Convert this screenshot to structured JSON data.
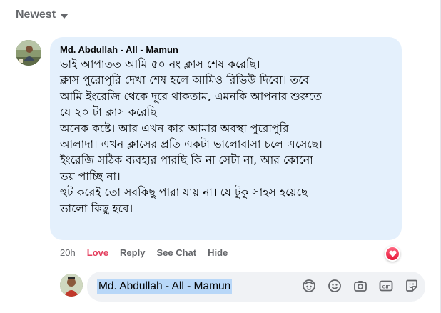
{
  "sort": {
    "label": "Newest",
    "icon": "caret-down-icon"
  },
  "comment": {
    "author": "Md. Abdullah - All - Mamun",
    "avatar_icon": "user-avatar",
    "lines": [
      "ভাই আপাতত আমি ৫০ নং ক্লাস শেষ করেছি।",
      "ক্লাস পুরোপুরি দেখা শেষ হলে আমিও রিভিউ দিবো। তবে",
      "আমি ইংরেজি থেকে দূরে থাকতাম, এমনকি আপনার শুরুতে",
      "যে ২০ টা ক্লাস করেছি",
      "অনেক কষ্টে। আর এখন কার আমার অবস্থা পুরোপুরি",
      "আলাদা। এখন ক্লাসের প্রতি একটা ভালোবাসা চলে এসেছে।",
      "ইংরেজি সঠিক ব্যবহার পারছি কি না সেটা না, আর কোনো",
      "ভয় পাচ্ছি না।",
      "হুট করেই তো সবকিছু পারা যায় না। যে টুকু সাহস হয়েছে",
      "ভালো কিছু হবে।"
    ],
    "bubble_color": "#e4f0fc"
  },
  "actions": {
    "time": "20h",
    "love": "Love",
    "reply": "Reply",
    "see_chat": "See Chat",
    "hide": "Hide",
    "love_color": "#e4405f"
  },
  "reaction": {
    "icon": "heart-reaction-icon"
  },
  "composer": {
    "value": "Md. Abdullah - All - Mamun",
    "icons": [
      "avatar-sticker-icon",
      "emoji-icon",
      "camera-icon",
      "gif-icon",
      "sticker-icon"
    ]
  }
}
